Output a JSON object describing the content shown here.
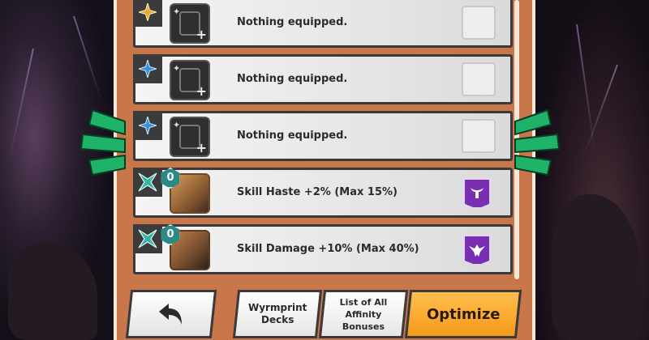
{
  "slots": [
    {
      "kind": "empty",
      "slot_icon": "gold-star-icon",
      "label": "Nothing equipped."
    },
    {
      "kind": "empty",
      "slot_icon": "blue-star-icon",
      "label": "Nothing equipped."
    },
    {
      "kind": "empty",
      "slot_icon": "blue-star-icon",
      "label": "Nothing equipped."
    },
    {
      "kind": "filled",
      "slot_icon": "teal-crossed-icon",
      "unbind": "0",
      "label": "Skill Haste +2% (Max 15%)",
      "ability_icon": "bull-emblem-icon"
    },
    {
      "kind": "filled",
      "slot_icon": "teal-crossed-icon",
      "unbind": "0",
      "label": "Skill Damage +10% (Max 40%)",
      "ability_icon": "eagle-emblem-icon"
    }
  ],
  "buttons": {
    "back": "back-arrow-icon",
    "decks_line1": "Wyrmprint",
    "decks_line2": "Decks",
    "bonus_line1": "List of All",
    "bonus_line2": "Affinity Bonuses",
    "optimize": "Optimize"
  },
  "colors": {
    "panel": "#c9774a",
    "optimize": "#f59a1a",
    "ability_badge": "#7a2fb3",
    "side_tab": "#1fb36a"
  }
}
